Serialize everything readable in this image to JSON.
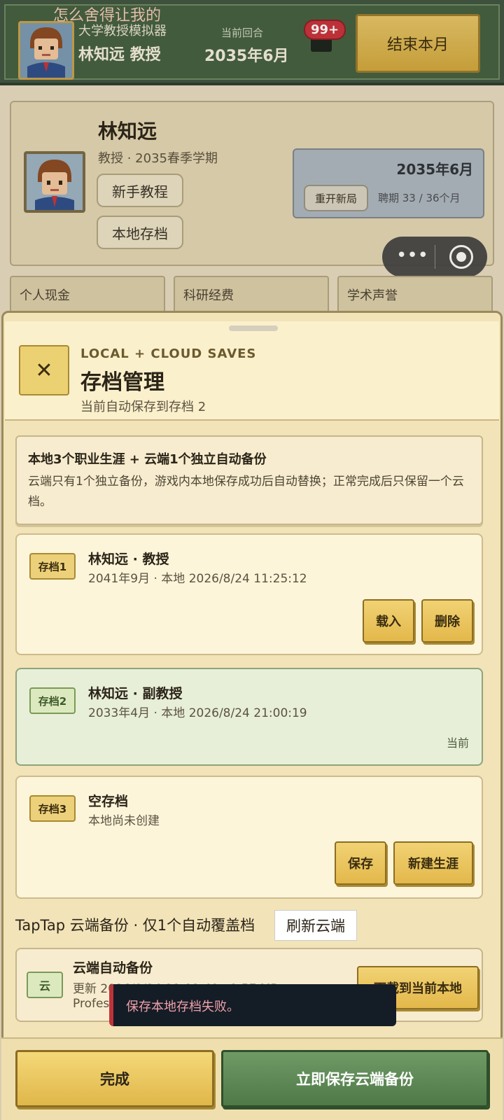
{
  "hud": {
    "marquee": "⁠怎么舍得让我的",
    "game_title": "大学教授模拟器",
    "player": "林知远 教授",
    "turn_label": "当前回合",
    "turn_value": "2035年6月",
    "mail_badge": "99+",
    "end_month": "结束本月"
  },
  "profile": {
    "name": "林知远",
    "subtitle": "教授 · 2035春季学期",
    "tutorial": "新手教程",
    "local_saves": "本地存档",
    "date": "2035年6月",
    "restart": "重开新局",
    "term": "聘期 33 / 36个月"
  },
  "stats": [
    "个人现金",
    "科研经费",
    "学术声誉"
  ],
  "modal": {
    "kicker": "LOCAL + CLOUD SAVES",
    "title": "存档管理",
    "subtitle": "当前自动保存到存档 2",
    "info_title": "本地3个职业生涯 + 云端1个独立自动备份",
    "info_text": "云端只有1个独立备份，游戏内本地保存成功后自动替换；正常完成后只保留一个云档。",
    "slots": [
      {
        "tag": "存档1",
        "name": "林知远 · 教授",
        "meta": "2041年9月 · 本地 2026/8/24 11:25:12",
        "btn1": "载入",
        "btn2": "删除"
      },
      {
        "tag": "存档2",
        "name": "林知远 · 副教授",
        "meta": "2033年4月 · 本地 2026/8/24 21:00:19",
        "status": "当前"
      },
      {
        "tag": "存档3",
        "name": "空存档",
        "meta": "本地尚未创建",
        "btn1": "保存",
        "btn2": "新建生涯"
      }
    ],
    "cloud_heading": "TapTap 云端备份 · 仅1个自动覆盖档",
    "refresh": "刷新云端",
    "cloud_tag": "云",
    "cloud_title": "云端自动备份",
    "cloud_meta": "更新 2026/8/24 21:01:48 · 1.57 MB",
    "cloud_meta2": "Profes",
    "cloud_download": "下载到当前本地",
    "toast": "保存本地存档失败。",
    "done": "完成",
    "save_cloud": "立即保存云端备份"
  },
  "mini_program": {
    "more": "•••"
  }
}
